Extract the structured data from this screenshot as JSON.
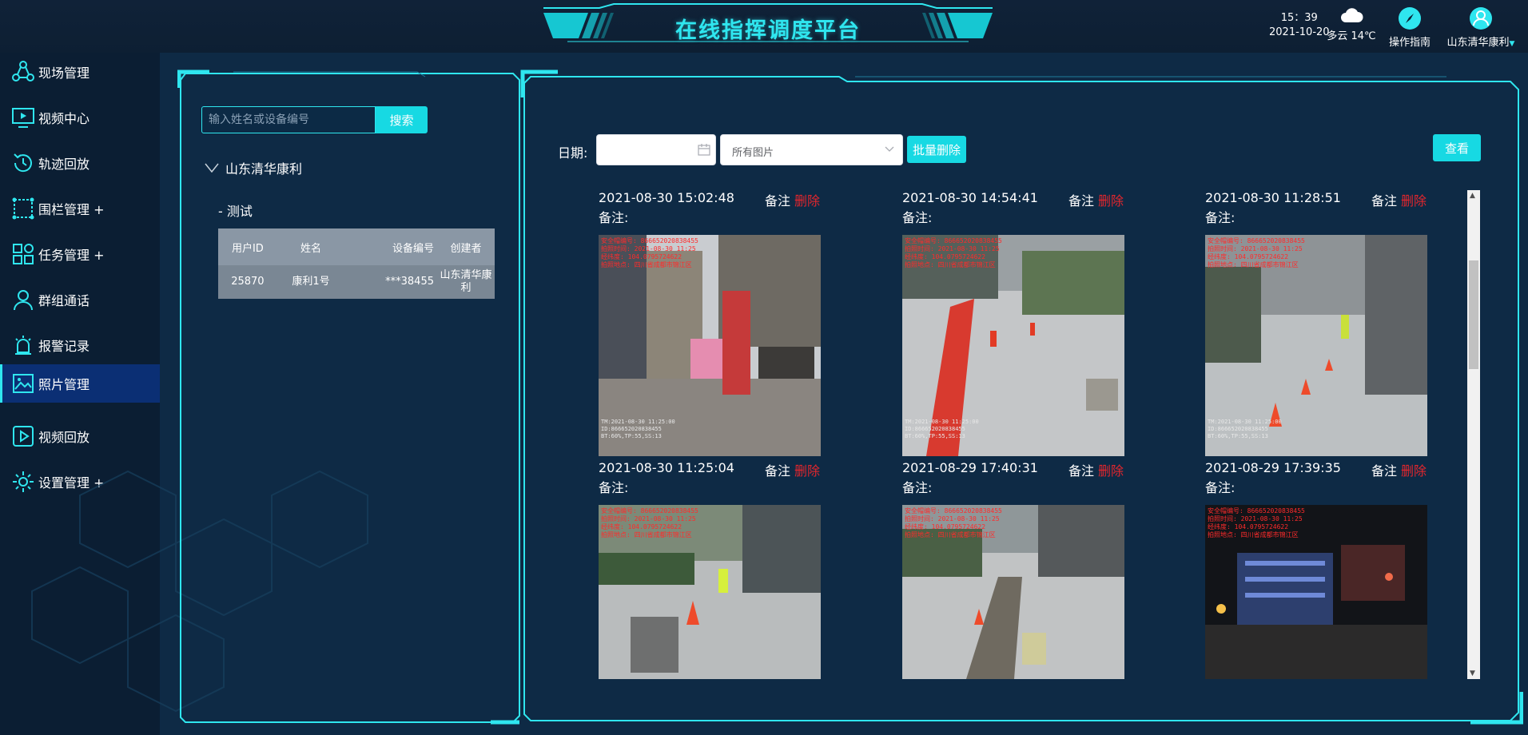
{
  "header": {
    "title": "在线指挥调度平台",
    "time": "15：39",
    "date": "2021-10-20",
    "weather": "多云 14℃",
    "guide": "操作指南",
    "user": "山东清华康利",
    "accent": "#2fe6ef"
  },
  "sidebar": {
    "items": [
      {
        "label": "现场管理",
        "icon": "share-nodes-icon"
      },
      {
        "label": "视频中心",
        "icon": "monitor-icon"
      },
      {
        "label": "轨迹回放",
        "icon": "history-icon"
      },
      {
        "label": "围栏管理 +",
        "icon": "fence-icon"
      },
      {
        "label": "任务管理 +",
        "icon": "grid-icon"
      },
      {
        "label": "群组通话",
        "icon": "user-icon"
      },
      {
        "label": "报警记录",
        "icon": "alarm-icon"
      },
      {
        "label": "照片管理",
        "icon": "photo-icon"
      },
      {
        "label": "视频回放",
        "icon": "play-icon"
      },
      {
        "label": "设置管理 +",
        "icon": "settings-icon"
      }
    ],
    "active_index": 7
  },
  "left_panel": {
    "search_placeholder": "输入姓名或设备编号",
    "search_button": "搜索",
    "tree_root": "山东清华康利",
    "tree_child": "- 测试",
    "table": {
      "headers": [
        "用户ID",
        "姓名",
        "设备编号",
        "创建者"
      ],
      "rows": [
        [
          "25870",
          "康利1号",
          "***38455",
          "山东清华康利"
        ]
      ]
    }
  },
  "filters": {
    "date_label": "日期:",
    "date_value": "",
    "select_value": "所有图片",
    "batch_delete": "批量删除",
    "view": "查看"
  },
  "photos": [
    {
      "time": "2021-08-30 15:02:48",
      "note": "备注",
      "delete": "删除",
      "remark": "备注:"
    },
    {
      "time": "2021-08-30 14:54:41",
      "note": "备注",
      "delete": "删除",
      "remark": "备注:"
    },
    {
      "time": "2021-08-30 11:28:51",
      "note": "备注",
      "delete": "删除",
      "remark": "备注:"
    },
    {
      "time": "2021-08-30 11:25:04",
      "note": "备注",
      "delete": "删除",
      "remark": "备注:"
    },
    {
      "time": "2021-08-29 17:40:31",
      "note": "备注",
      "delete": "删除",
      "remark": "备注:"
    },
    {
      "time": "2021-08-29 17:39:35",
      "note": "备注",
      "delete": "删除",
      "remark": "备注:"
    }
  ],
  "watermark": {
    "lines": [
      "安全帽编号: 866652020838455",
      "拍照时间: 2021-08-30 11:25",
      "经纬度: 104.0795724622",
      "拍照地点: 四川省成都市锦江区"
    ],
    "foot": [
      "TM:2021-08-30 11:25:00",
      "ID:866652020838455",
      "BT:60%,TP:55,SS:13"
    ]
  }
}
